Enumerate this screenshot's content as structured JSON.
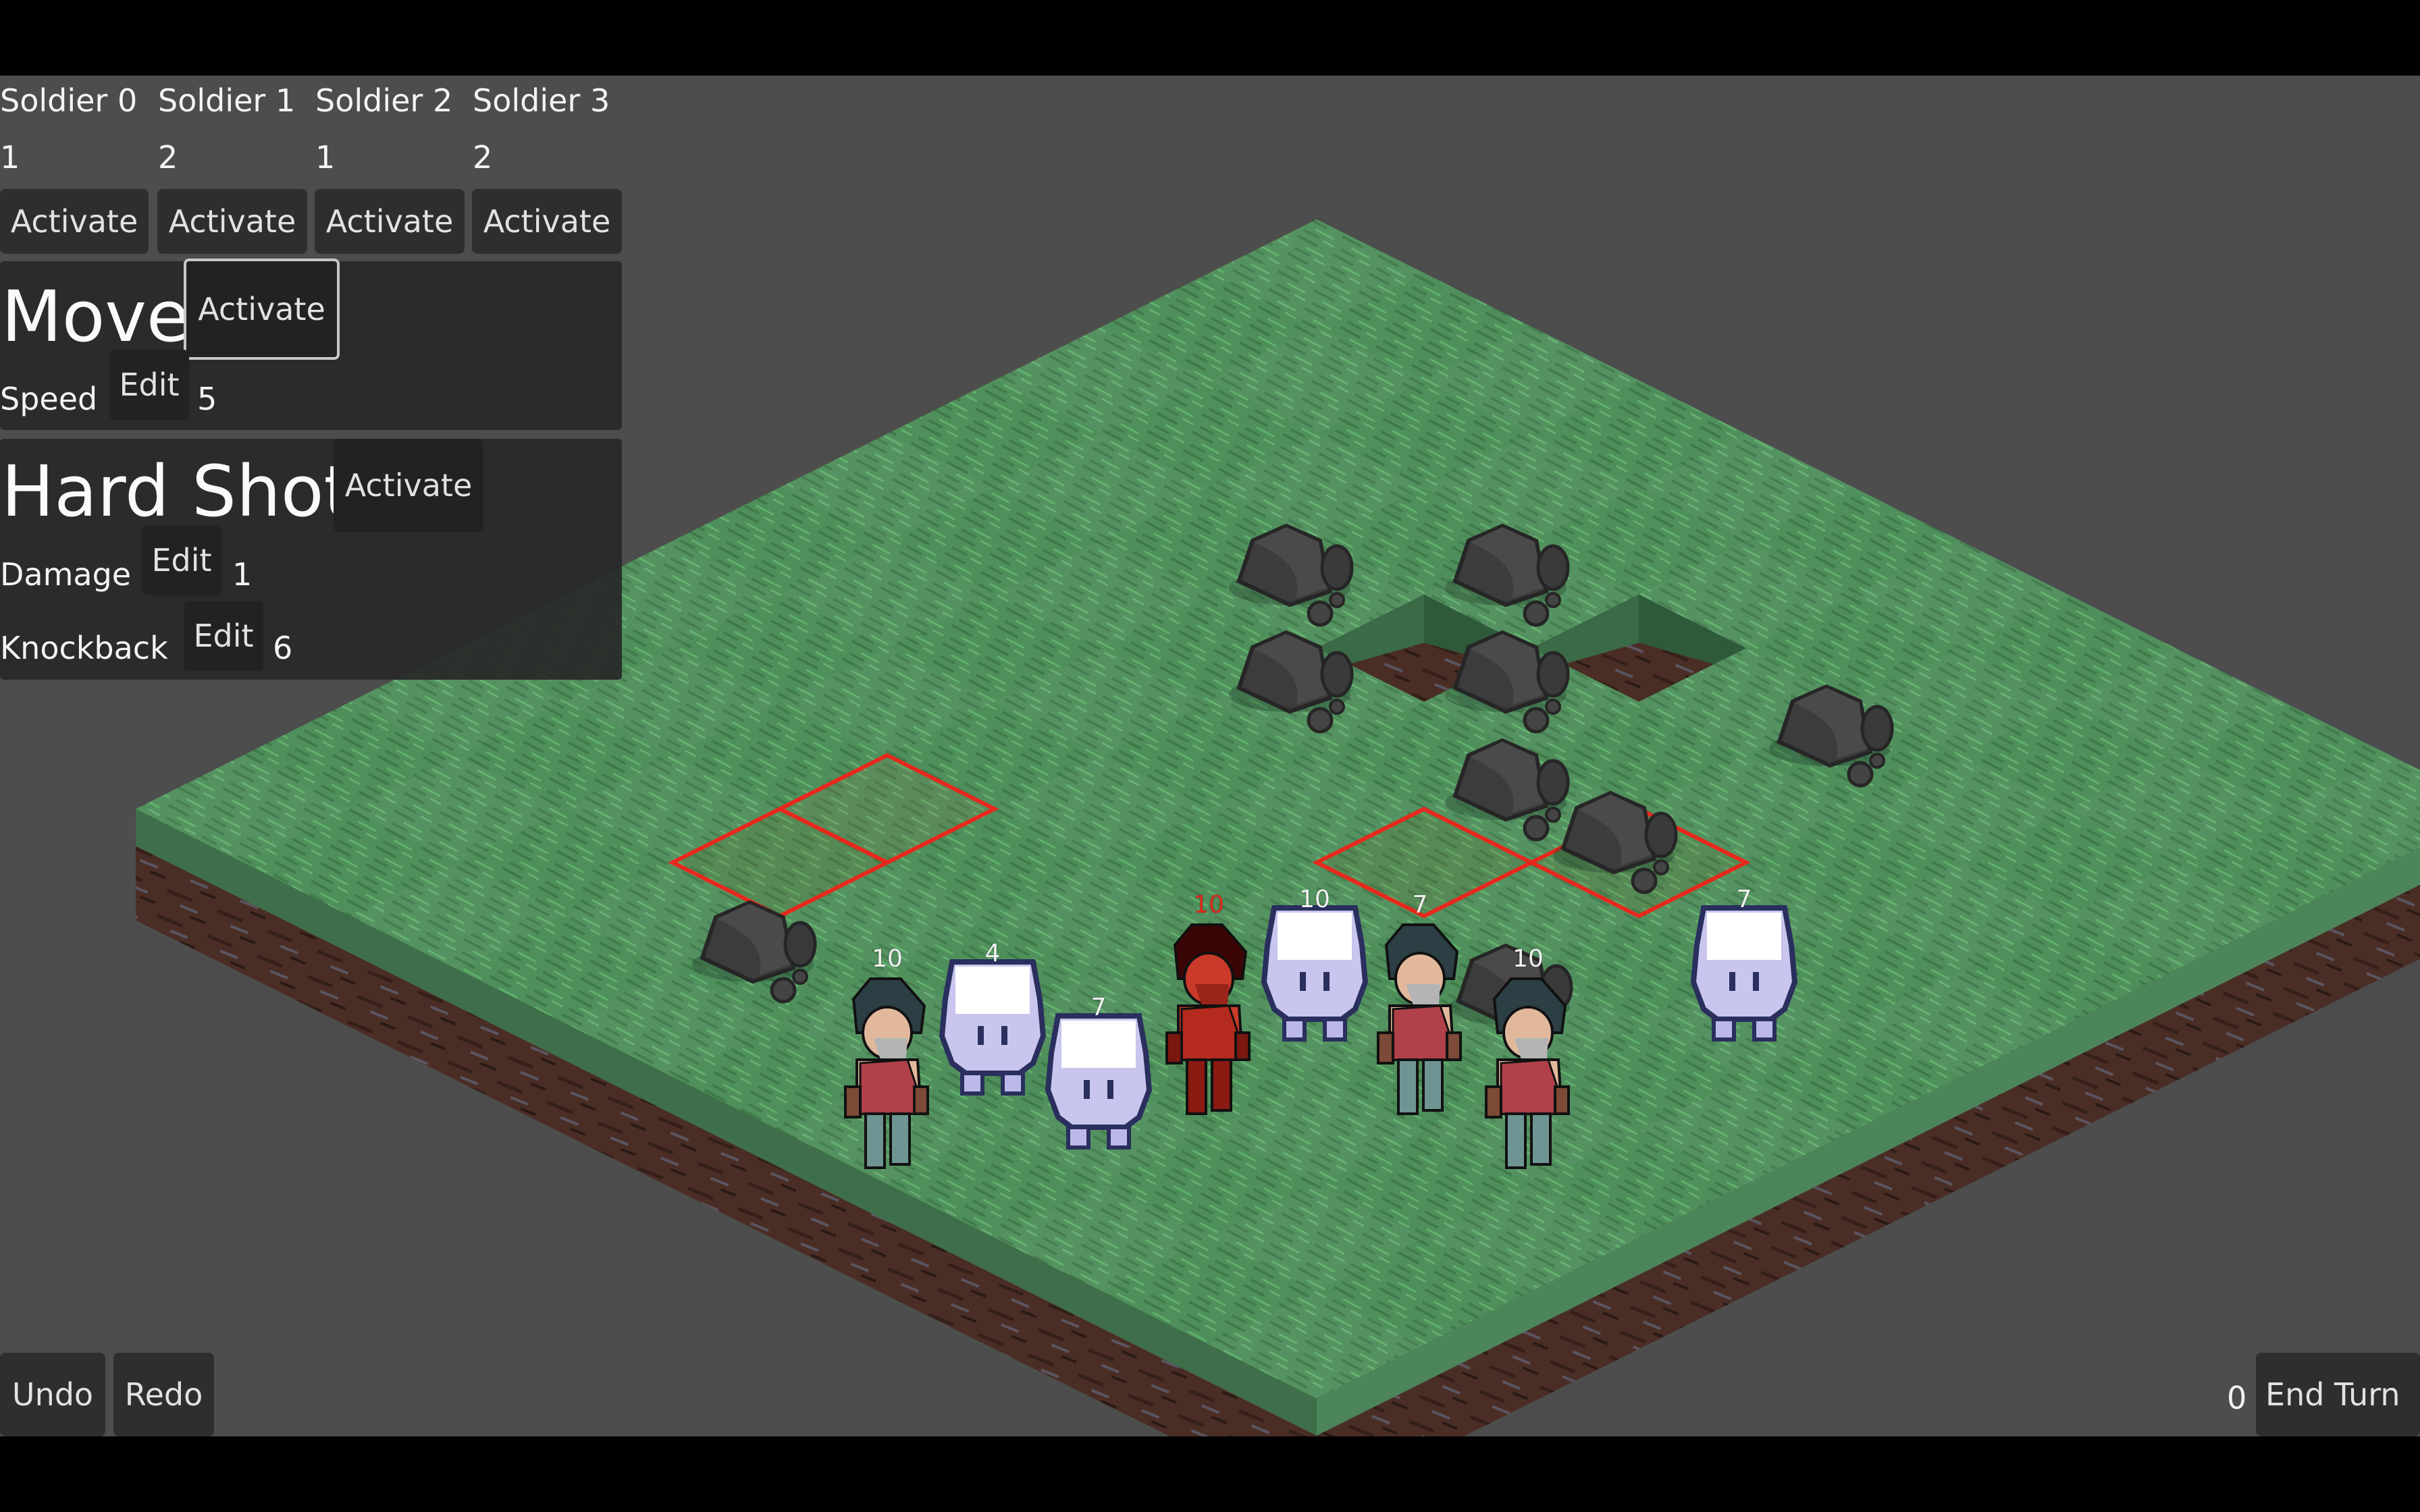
{
  "soldiers": [
    {
      "name": "Soldier 0",
      "value": "1",
      "button": "Activate"
    },
    {
      "name": "Soldier 1",
      "value": "2",
      "button": "Activate"
    },
    {
      "name": "Soldier 2",
      "value": "1",
      "button": "Activate"
    },
    {
      "name": "Soldier 3",
      "value": "2",
      "button": "Activate"
    }
  ],
  "abilities": {
    "move": {
      "title": "Move",
      "activate_label": "Activate",
      "stats": [
        {
          "label": "Speed",
          "edit_label": "Edit",
          "value": "5"
        }
      ]
    },
    "hard_shot": {
      "title": "Hard Shot",
      "activate_label": "Activate",
      "stats": [
        {
          "label": "Damage",
          "edit_label": "Edit",
          "value": "1"
        },
        {
          "label": "Knockback",
          "edit_label": "Edit",
          "value": "6"
        }
      ]
    }
  },
  "bottom_bar": {
    "undo_label": "Undo",
    "redo_label": "Redo",
    "turn_counter": "0",
    "end_turn_label": "End Turn"
  },
  "board": {
    "size": [
      11,
      11
    ],
    "terrain": "grass",
    "colors": {
      "grass": "#4f8f5c",
      "grass_light": "#5da36a",
      "dirt": "#4a2e26",
      "highlight": "#e8281c",
      "enemy": "#c9281c"
    },
    "rocks": [
      [
        3,
        0
      ],
      [
        5,
        0
      ],
      [
        3,
        1
      ],
      [
        5,
        1
      ],
      [
        5,
        2
      ],
      [
        6,
        2
      ],
      [
        7,
        0
      ],
      [
        2,
        5
      ],
      [
        7,
        4
      ]
    ],
    "pits": [
      [
        4,
        3
      ],
      [
        5,
        2
      ]
    ],
    "units": [
      {
        "type": "soldier",
        "team": "player",
        "hp": "10",
        "icon": "soldier-sprite"
      },
      {
        "type": "ghost",
        "team": "neutral",
        "hp": "4",
        "icon": "ghost-sprite"
      },
      {
        "type": "ghost",
        "team": "neutral",
        "hp": "7",
        "icon": "ghost-sprite"
      },
      {
        "type": "soldier",
        "team": "enemy",
        "hp": "10",
        "icon": "enemy-soldier-sprite"
      },
      {
        "type": "ghost",
        "team": "neutral",
        "hp": "10",
        "icon": "ghost-sprite"
      },
      {
        "type": "soldier",
        "team": "player",
        "hp": "7",
        "icon": "soldier-sprite"
      },
      {
        "type": "soldier",
        "team": "player",
        "hp": "10",
        "icon": "soldier-sprite"
      },
      {
        "type": "ghost",
        "team": "neutral",
        "hp": "7",
        "icon": "ghost-sprite"
      }
    ]
  }
}
